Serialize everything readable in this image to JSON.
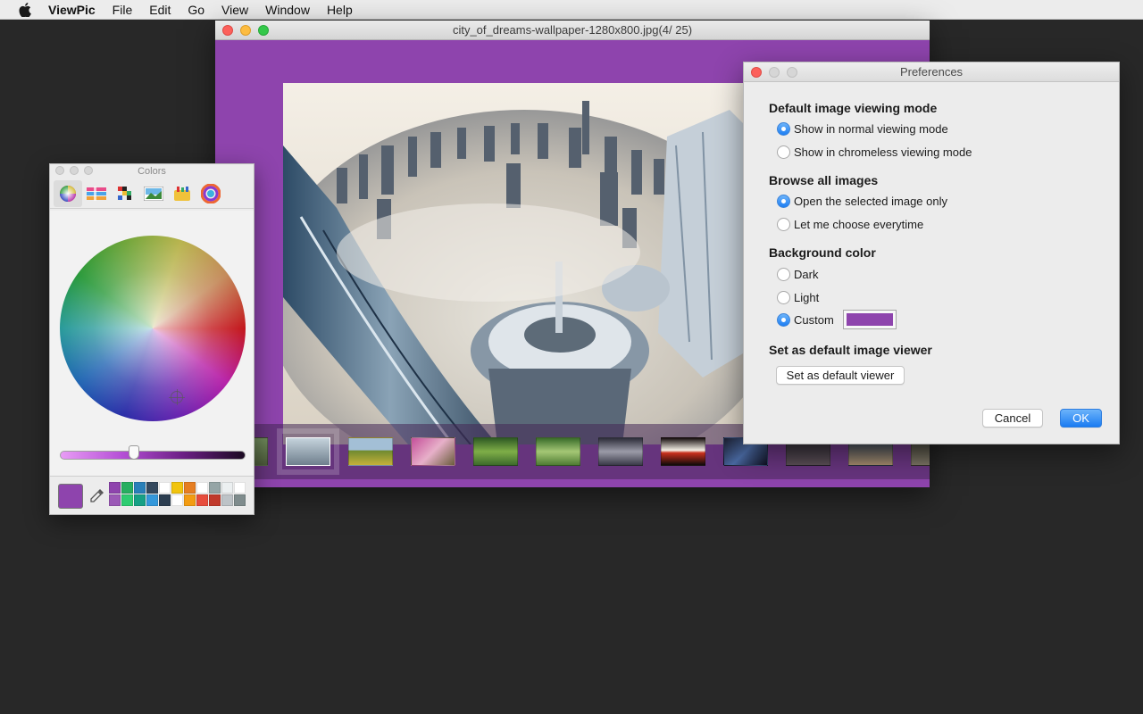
{
  "menubar": {
    "apple_icon": "apple-logo-icon",
    "app_name": "ViewPic",
    "items": [
      "File",
      "Edit",
      "Go",
      "View",
      "Window",
      "Help"
    ]
  },
  "viewer": {
    "title": "city_of_dreams-wallpaper-1280x800.jpg(4/ 25)",
    "background_color": "#8e44ad",
    "thumbnails": [
      {
        "name": "thumb-1",
        "selected": false
      },
      {
        "name": "thumb-2",
        "selected": true
      },
      {
        "name": "thumb-3",
        "selected": false
      },
      {
        "name": "thumb-4",
        "selected": false
      },
      {
        "name": "thumb-5",
        "selected": false
      },
      {
        "name": "thumb-6",
        "selected": false
      },
      {
        "name": "thumb-7",
        "selected": false
      },
      {
        "name": "thumb-8",
        "selected": false
      },
      {
        "name": "thumb-9",
        "selected": false
      },
      {
        "name": "thumb-10",
        "selected": false
      },
      {
        "name": "thumb-11",
        "selected": false
      },
      {
        "name": "thumb-12",
        "selected": false
      }
    ]
  },
  "colors_panel": {
    "title": "Colors",
    "tabs": [
      "color-wheel-icon",
      "color-sliders-icon",
      "color-palettes-icon",
      "image-palettes-icon",
      "crayons-icon",
      "spectrum-icon"
    ],
    "active_tab": "color-wheel-icon",
    "current_color": "#8e44ad",
    "brightness_level": 0.4,
    "swatches": [
      "#8e44ad",
      "#27ae60",
      "#2980b9",
      "#34495e",
      "#ffffff",
      "#f1c40f",
      "#e67e22",
      "#ffffff",
      "#95a5a6",
      "#ecf0f1",
      "#ffffff",
      "#9b59b6",
      "#2ecc71",
      "#16a085",
      "#3498db",
      "#2c3e50",
      "#ffffff",
      "#f39c12",
      "#e74c3c",
      "#c0392b",
      "#bdc3c7",
      "#7f8c8d"
    ]
  },
  "preferences": {
    "title": "Preferences",
    "viewing_mode": {
      "heading": "Default image viewing mode",
      "options": [
        {
          "label": "Show in normal viewing mode",
          "checked": true
        },
        {
          "label": "Show in chromeless viewing mode",
          "checked": false
        }
      ]
    },
    "browse": {
      "heading": "Browse all images",
      "options": [
        {
          "label": "Open the selected image only",
          "checked": true
        },
        {
          "label": "Let me choose everytime",
          "checked": false
        }
      ]
    },
    "background": {
      "heading": "Background color",
      "options": [
        {
          "label": "Dark",
          "checked": false
        },
        {
          "label": "Light",
          "checked": false
        },
        {
          "label": "Custom",
          "checked": true
        }
      ],
      "custom_color": "#8e44ad"
    },
    "default_viewer": {
      "heading": "Set as default image viewer",
      "button": "Set as default viewer"
    },
    "cancel_label": "Cancel",
    "ok_label": "OK"
  }
}
